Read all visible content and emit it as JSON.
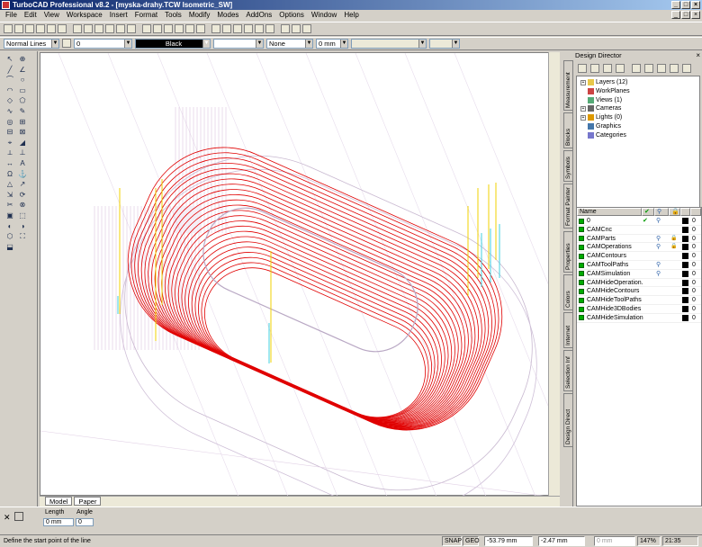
{
  "window": {
    "title": "TurboCAD Professional v8.2 - [myska-drahy.TCW Isometric_SW]"
  },
  "menu": [
    "File",
    "Edit",
    "View",
    "Workspace",
    "Insert",
    "Format",
    "Tools",
    "Modify",
    "Modes",
    "AddOns",
    "Options",
    "Window",
    "Help"
  ],
  "props": {
    "line_style": "Normal Lines",
    "width": "0",
    "color": "Black",
    "pattern": "None",
    "thickness": "0 mm"
  },
  "view_tabs": [
    "Model",
    "Paper"
  ],
  "design_director": {
    "title": "Design Director",
    "tree": [
      {
        "label": "Layers (12)",
        "expand": true
      },
      {
        "label": "WorkPlanes",
        "expand": false
      },
      {
        "label": "Views (1)",
        "expand": false
      },
      {
        "label": "Cameras",
        "expand": true
      },
      {
        "label": "Lights (0)",
        "expand": true
      },
      {
        "label": "Graphics",
        "expand": false
      },
      {
        "label": "Categories",
        "expand": false
      }
    ],
    "side_tabs": [
      "Measurement",
      "Blocks",
      "Symbols",
      "Format Painter",
      "Properties",
      "Colors",
      "Internet",
      "Selection Inf",
      "Design Direct"
    ],
    "layer_header": {
      "name": "Name"
    },
    "layers": [
      {
        "name": "0",
        "visible": true,
        "snap": true,
        "lock": false,
        "count": "0"
      },
      {
        "name": "CAMCnc",
        "visible": false,
        "snap": false,
        "lock": false,
        "count": "0"
      },
      {
        "name": "CAMParts",
        "visible": false,
        "snap": true,
        "lock": true,
        "count": "0"
      },
      {
        "name": "CAMOperations",
        "visible": false,
        "snap": true,
        "lock": true,
        "count": "0"
      },
      {
        "name": "CAMContours",
        "visible": false,
        "snap": false,
        "lock": false,
        "count": "0"
      },
      {
        "name": "CAMToolPaths",
        "visible": false,
        "snap": true,
        "lock": false,
        "count": "0"
      },
      {
        "name": "CAMSimulation",
        "visible": false,
        "snap": true,
        "lock": false,
        "count": "0"
      },
      {
        "name": "CAMHideOperation.",
        "visible": false,
        "snap": false,
        "lock": false,
        "count": "0"
      },
      {
        "name": "CAMHideContours",
        "visible": false,
        "snap": false,
        "lock": false,
        "count": "0"
      },
      {
        "name": "CAMHideToolPaths",
        "visible": false,
        "snap": false,
        "lock": false,
        "count": "0"
      },
      {
        "name": "CAMHide3DBodies",
        "visible": false,
        "snap": false,
        "lock": false,
        "count": "0"
      },
      {
        "name": "CAMHideSimulation",
        "visible": false,
        "snap": false,
        "lock": false,
        "count": "0"
      }
    ]
  },
  "inspector": {
    "length_label": "Length",
    "angle_label": "Angle",
    "length_value": "0 mm",
    "angle_value": "0"
  },
  "status": {
    "prompt": "Define the start point of the line",
    "snap": "SNAP",
    "geo": "GEO",
    "x": "-53.79 mm",
    "y": "-2.47 mm",
    "z": "0 mm",
    "zoom": "147%",
    "time": "21:35"
  },
  "colors": {
    "path": "#e00000",
    "title_start": "#0a246a",
    "title_end": "#a6caf0"
  }
}
